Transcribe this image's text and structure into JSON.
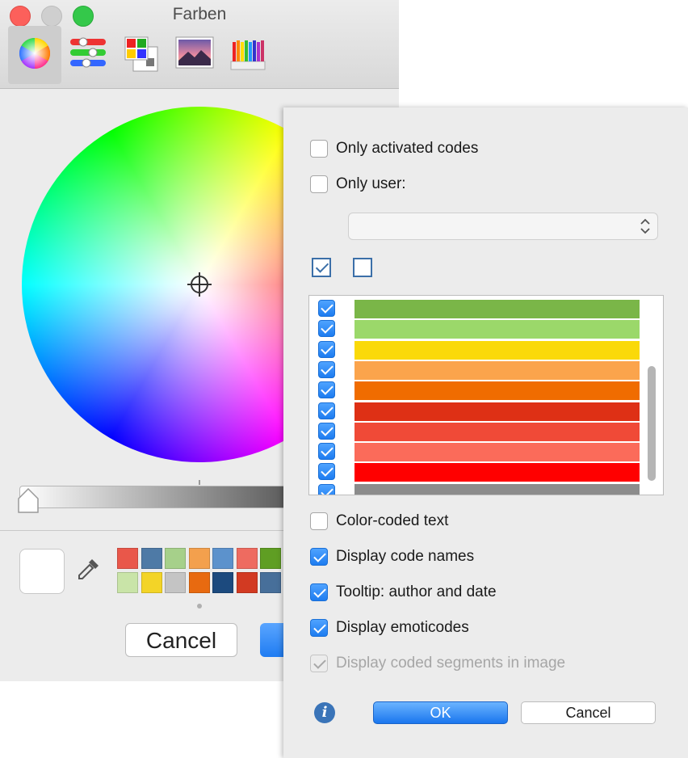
{
  "color_picker": {
    "title": "Farben",
    "toolbar": [
      {
        "name": "color-wheel-tab",
        "icon": "color-wheel-icon",
        "active": true
      },
      {
        "name": "color-sliders-tab",
        "icon": "color-sliders-icon",
        "active": false
      },
      {
        "name": "color-palettes-tab",
        "icon": "color-palettes-icon",
        "active": false
      },
      {
        "name": "image-palettes-tab",
        "icon": "image-palettes-icon",
        "active": false
      },
      {
        "name": "pencils-tab",
        "icon": "pencils-icon",
        "active": false
      }
    ],
    "brightness_level": 0.0,
    "current_color": "#ffffff",
    "swatches_row1": [
      "#e9574a",
      "#4e7aa6",
      "#a6d08a",
      "#f3a04d",
      "#5c92cc",
      "#ee6b60",
      "#5f9e23"
    ],
    "swatches_row2": [
      "#c9e4a8",
      "#f3d427",
      "#c4c4c4",
      "#e86a10",
      "#1c4a7e",
      "#d23a22",
      "#476f9a"
    ],
    "cancel_label": "Cancel"
  },
  "settings": {
    "only_activated_codes": {
      "label": "Only activated codes",
      "checked": false
    },
    "only_user": {
      "label": "Only user:",
      "checked": false
    },
    "user_dropdown": {
      "value": ""
    },
    "code_colors": [
      {
        "checked": true,
        "color": "#7ab648"
      },
      {
        "checked": true,
        "color": "#9bd86a"
      },
      {
        "checked": true,
        "color": "#fad909"
      },
      {
        "checked": true,
        "color": "#fba44c"
      },
      {
        "checked": true,
        "color": "#f06c00"
      },
      {
        "checked": true,
        "color": "#de3015"
      },
      {
        "checked": true,
        "color": "#f04a37"
      },
      {
        "checked": true,
        "color": "#fb6b5a"
      },
      {
        "checked": true,
        "color": "#ff0000"
      },
      {
        "checked": true,
        "color": "#8c8c8c"
      }
    ],
    "options": [
      {
        "name": "color-coded-text-checkbox",
        "label": "Color-coded text",
        "checked": false,
        "disabled": false
      },
      {
        "name": "display-code-names-checkbox",
        "label": "Display code names",
        "checked": true,
        "disabled": false
      },
      {
        "name": "tooltip-author-date-checkbox",
        "label": "Tooltip: author and date",
        "checked": true,
        "disabled": false
      },
      {
        "name": "display-emoticodes-checkbox",
        "label": "Display emoticodes",
        "checked": true,
        "disabled": false
      },
      {
        "name": "display-coded-segments-checkbox",
        "label": "Display coded segments in image",
        "checked": true,
        "disabled": true
      }
    ],
    "ok_label": "OK",
    "cancel_label": "Cancel",
    "info_icon": "info-icon",
    "accent_color": "#1d7cf0"
  }
}
